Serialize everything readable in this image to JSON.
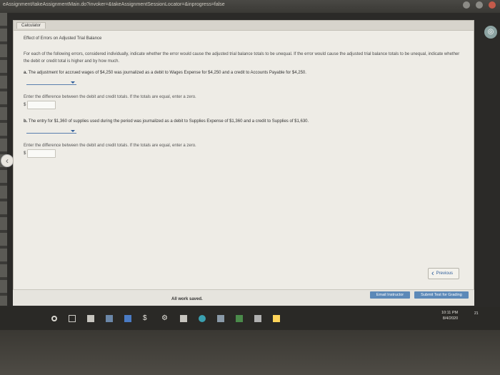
{
  "browser": {
    "url": "eAssignment/takeAssignmentMain.do?invoker=&takeAssignmentSessionLocator=&inprogress=false"
  },
  "window": {
    "tab_label": "Calculator"
  },
  "content": {
    "heading": "Effect of Errors on Adjusted Trial Balance",
    "intro": "For each of the following errors, considered individually, indicate whether the error would cause the adjusted trial balance totals to be unequal. If the error would cause the adjusted trial balance totals to be unequal, indicate whether the debit or credit total is higher and by how much.",
    "question_a_letter": "a.",
    "question_a": "The adjustment for accrued wages of $4,250 was journalized as a debit to Wages Expense for $4,250 and a credit to Accounts Payable for $4,250.",
    "instruction_a": "Enter the difference between the debit and credit totals. If the totals are equal, enter a zero.",
    "question_b_letter": "b.",
    "question_b": "The entry for $1,360 of supplies used during the period was journalized as a debit to Supplies Expense of $1,360 and a credit to Supplies of $1,630.",
    "instruction_b": "Enter the difference between the debit and credit totals. If the totals are equal, enter a zero.",
    "currency_symbol": "$"
  },
  "buttons": {
    "previous": "Previous",
    "email_instructor": "Email Instructor",
    "submit": "Submit Test for Grading"
  },
  "footer": {
    "saved_status": "All work saved."
  },
  "taskbar": {
    "time": "10:11 PM",
    "date": "8/4/2020",
    "notification_count": "21"
  }
}
